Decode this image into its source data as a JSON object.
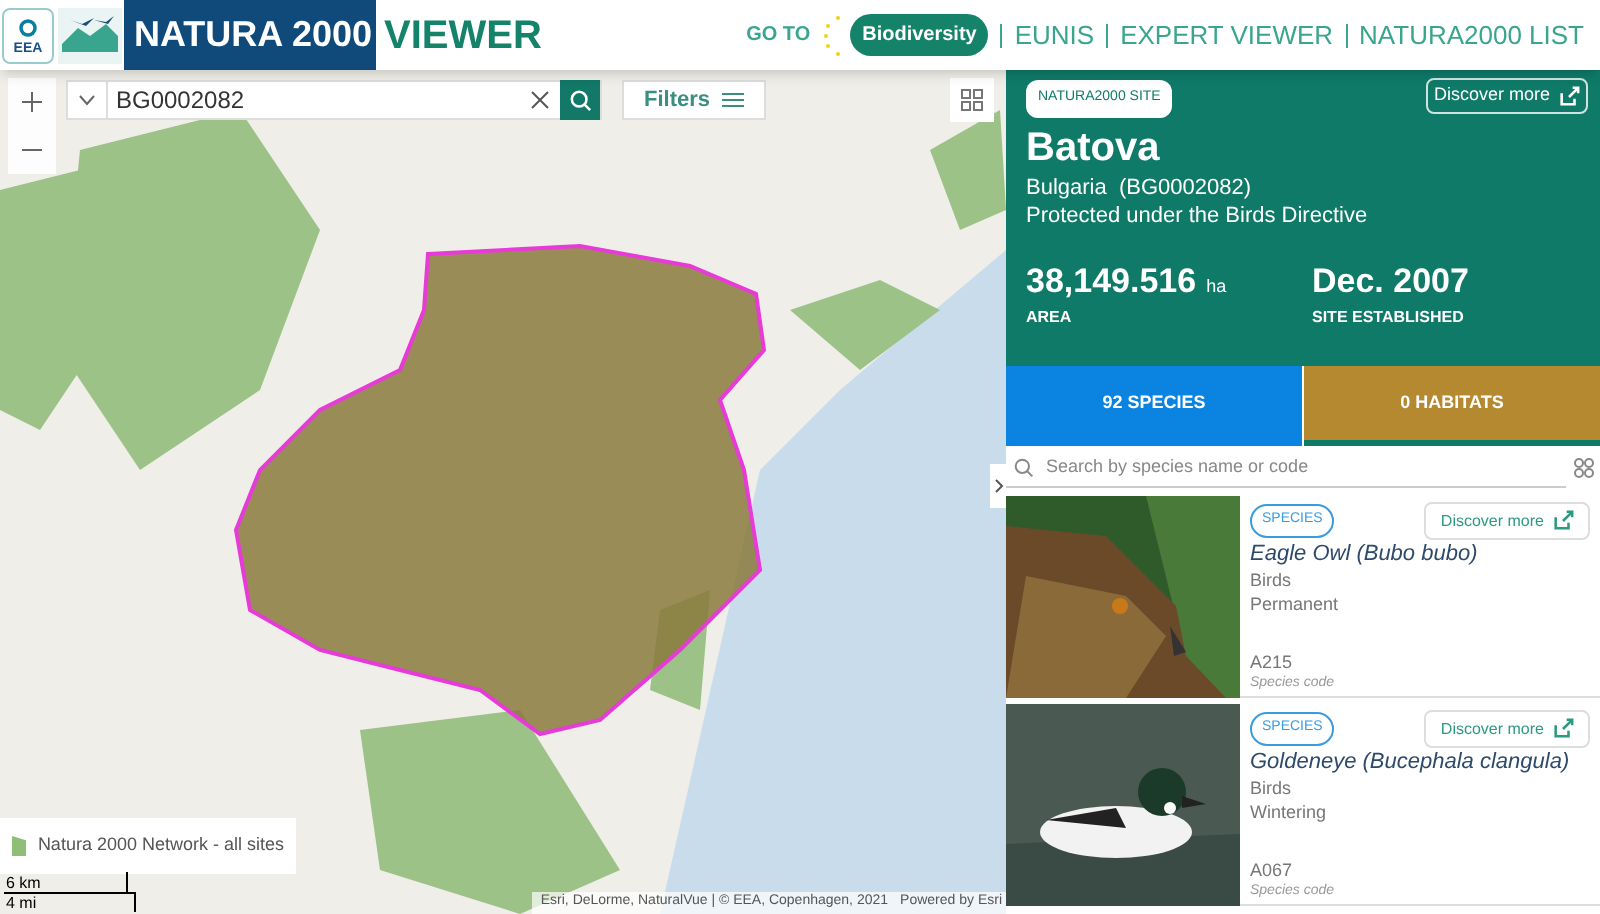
{
  "header": {
    "eea_logo": "EEA",
    "title": "NATURA 2000",
    "subtitle": "VIEWER",
    "go_to": "GO TO",
    "bise": "Biodiversity",
    "links": [
      "EUNIS",
      "EXPERT VIEWER",
      "NATURA2000 LIST"
    ]
  },
  "map": {
    "search": {
      "value": "BG0002082"
    },
    "filters": "Filters",
    "legend": "Natura 2000 Network - all sites",
    "scale": [
      "6 km",
      "4 mi"
    ],
    "attribution": "Esri, DeLorme, NaturalVue | © EEA, Copenhagen, 2021",
    "powered": "Powered by Esri"
  },
  "site": {
    "badge": "NATURA2000 SITE",
    "discover": "Discover more",
    "name": "Batova",
    "country": "Bulgaria  (BG0002082)",
    "protection": "Protected under the Birds Directive",
    "area": "38,149.516",
    "area_unit": "ha",
    "area_label": "AREA",
    "established": "Dec. 2007",
    "established_label": "SITE ESTABLISHED"
  },
  "tabs": [
    {
      "label": "92 SPECIES",
      "selected": true,
      "color": "#0a84e0"
    },
    {
      "label": "0 HABITATS",
      "selected": false,
      "color": "#b5892f"
    }
  ],
  "species_search": {
    "placeholder": "Search by species name or code"
  },
  "species": [
    {
      "kind": "picture",
      "badge": "SPECIES",
      "name": "Eagle Owl (Bubo bubo)",
      "group": "Birds",
      "status": "Permanent",
      "code": "A215",
      "code_label": "Species code",
      "discover": "Discover more"
    },
    {
      "kind": "picture",
      "badge": "SPECIES",
      "name": "Goldeneye (Bucephala clangula)",
      "group": "Birds",
      "status": "Wintering",
      "code": "A067",
      "code_label": "Species code",
      "discover": "Discover more"
    }
  ]
}
